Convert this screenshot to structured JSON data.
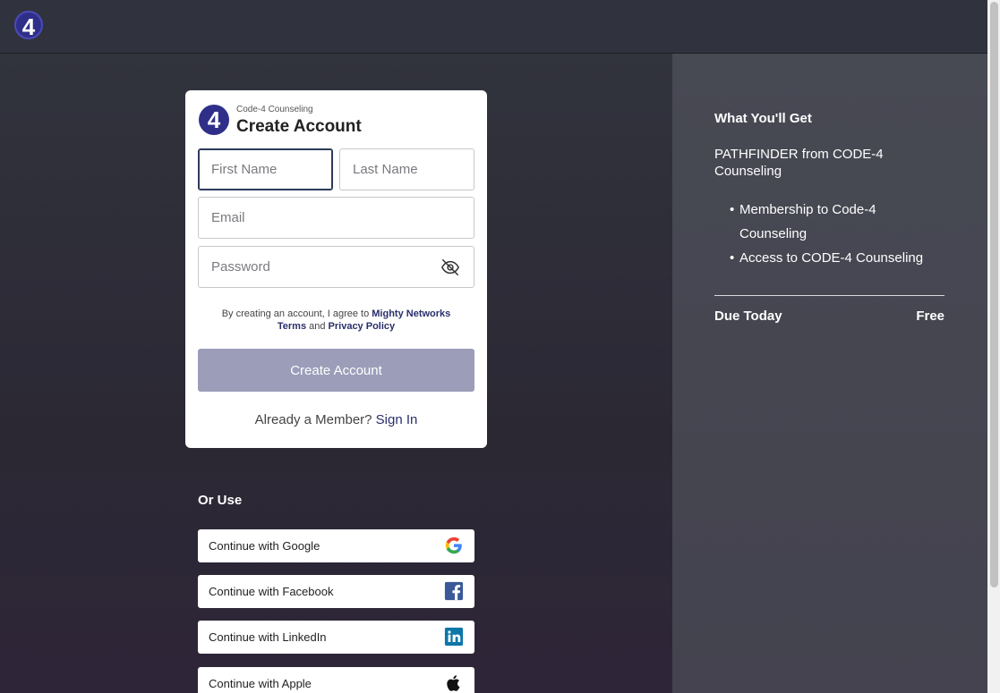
{
  "header": {
    "logo_text": "4"
  },
  "card": {
    "logo_text": "4",
    "org": "Code-4 Counseling",
    "title": "Create Account",
    "first_name_placeholder": "First Name",
    "last_name_placeholder": "Last Name",
    "email_placeholder": "Email",
    "password_placeholder": "Password",
    "terms_prefix": "By creating an account, I agree to ",
    "terms_link": "Mighty Networks Terms",
    "terms_and": " and ",
    "privacy_link": "Privacy Policy",
    "create_button": "Create Account",
    "member_prefix": "Already a Member? ",
    "sign_in": "Sign In"
  },
  "social": {
    "or_use": "Or Use",
    "google": "Continue with Google",
    "facebook": "Continue with Facebook",
    "linkedin": "Continue with LinkedIn",
    "apple": "Continue with Apple"
  },
  "summary": {
    "title": "What You'll Get",
    "product": "PATHFINDER from CODE-4 Counseling",
    "items": [
      "Membership to Code-4 Counseling",
      "Access to CODE-4 Counseling"
    ],
    "due_label": "Due Today",
    "due_value": "Free"
  }
}
